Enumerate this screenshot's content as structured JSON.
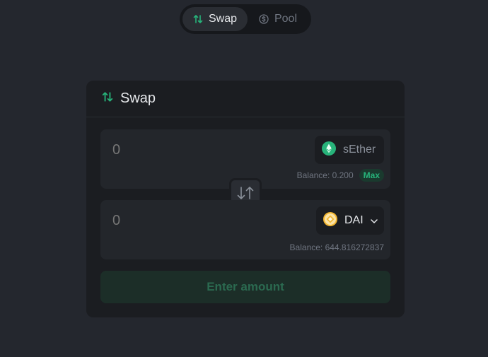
{
  "tabs": [
    {
      "label": "Swap",
      "icon": "swap-arrows-icon",
      "active": true
    },
    {
      "label": "Pool",
      "icon": "dollar-circle-icon",
      "active": false
    }
  ],
  "card": {
    "title": "Swap",
    "title_icon": "swap-arrows-icon"
  },
  "from": {
    "amount_placeholder": "0",
    "token": "sEther",
    "token_icon": "ether-icon",
    "balance": "Balance: 0.200",
    "max_label": "Max"
  },
  "to": {
    "amount_placeholder": "0",
    "token": "DAI",
    "token_icon": "dai-icon",
    "balance": "Balance: 644.816272837"
  },
  "switch_icon": "swap-vertical-arrows-icon",
  "submit_label": "Enter amount",
  "colors": {
    "background": "#24272e",
    "card": "#1b1d21",
    "accent": "#27b37a",
    "dai": "#f4b731"
  }
}
